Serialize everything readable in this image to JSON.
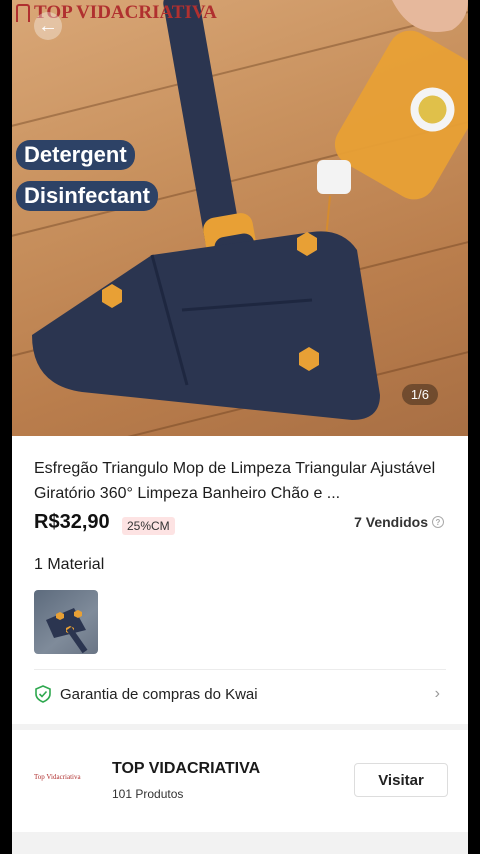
{
  "brand": {
    "name": "TOP VIDACRIATIVA"
  },
  "hero": {
    "tags": [
      "Detergent",
      "Disinfectant"
    ],
    "counter": "1/6"
  },
  "product": {
    "title": "Esfregão Triangulo Mop de Limpeza Triangular Ajustável Giratório 360° Limpeza Banheiro Chão e ...",
    "price": "R$32,90",
    "discount": "25%CM",
    "sold": "7 Vendidos",
    "material_label": "1 Material"
  },
  "guarantee": {
    "label": "Garantia de compras do Kwai"
  },
  "store": {
    "name": "TOP VIDACRIATIVA",
    "products": "101 Produtos",
    "visit_label": "Visitar",
    "logo_text": "Top Vidacriativa"
  },
  "icons": {
    "back": "arrow-left-icon",
    "shield": "shield-check-icon",
    "chevron": "chevron-right-icon",
    "info": "info-icon"
  },
  "colors": {
    "brand": "#b0302f",
    "tag_bg": "#2d4266",
    "mop": "#2b3550",
    "accent_orange": "#e8a035",
    "shield_green": "#2fa84f"
  }
}
